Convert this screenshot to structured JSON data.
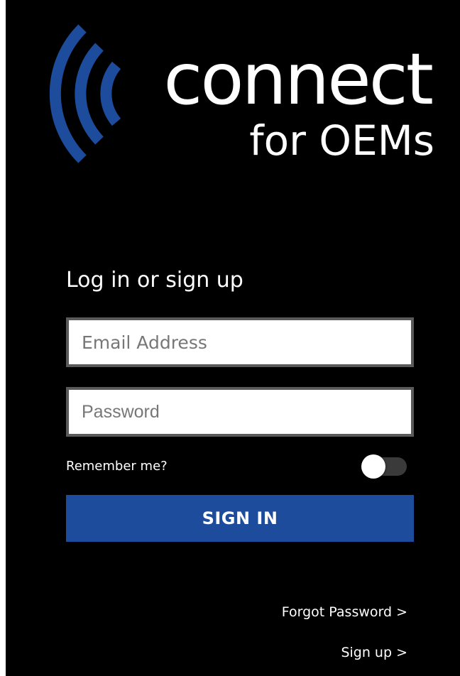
{
  "brand": {
    "word": "connect",
    "sub": "for OEMs",
    "colors": {
      "arcs": "#1d4c9c",
      "text": "#ffffff",
      "background": "#000000"
    }
  },
  "login": {
    "heading": "Log in or sign up",
    "email_placeholder": "Email Address",
    "password_placeholder": "Password",
    "remember_label": "Remember me?",
    "remember_on": false,
    "signin_label": "SIGN IN",
    "forgot_label": "Forgot Password >",
    "signup_label": "Sign up >"
  },
  "icons": {
    "logo": "signal-arcs-icon"
  }
}
